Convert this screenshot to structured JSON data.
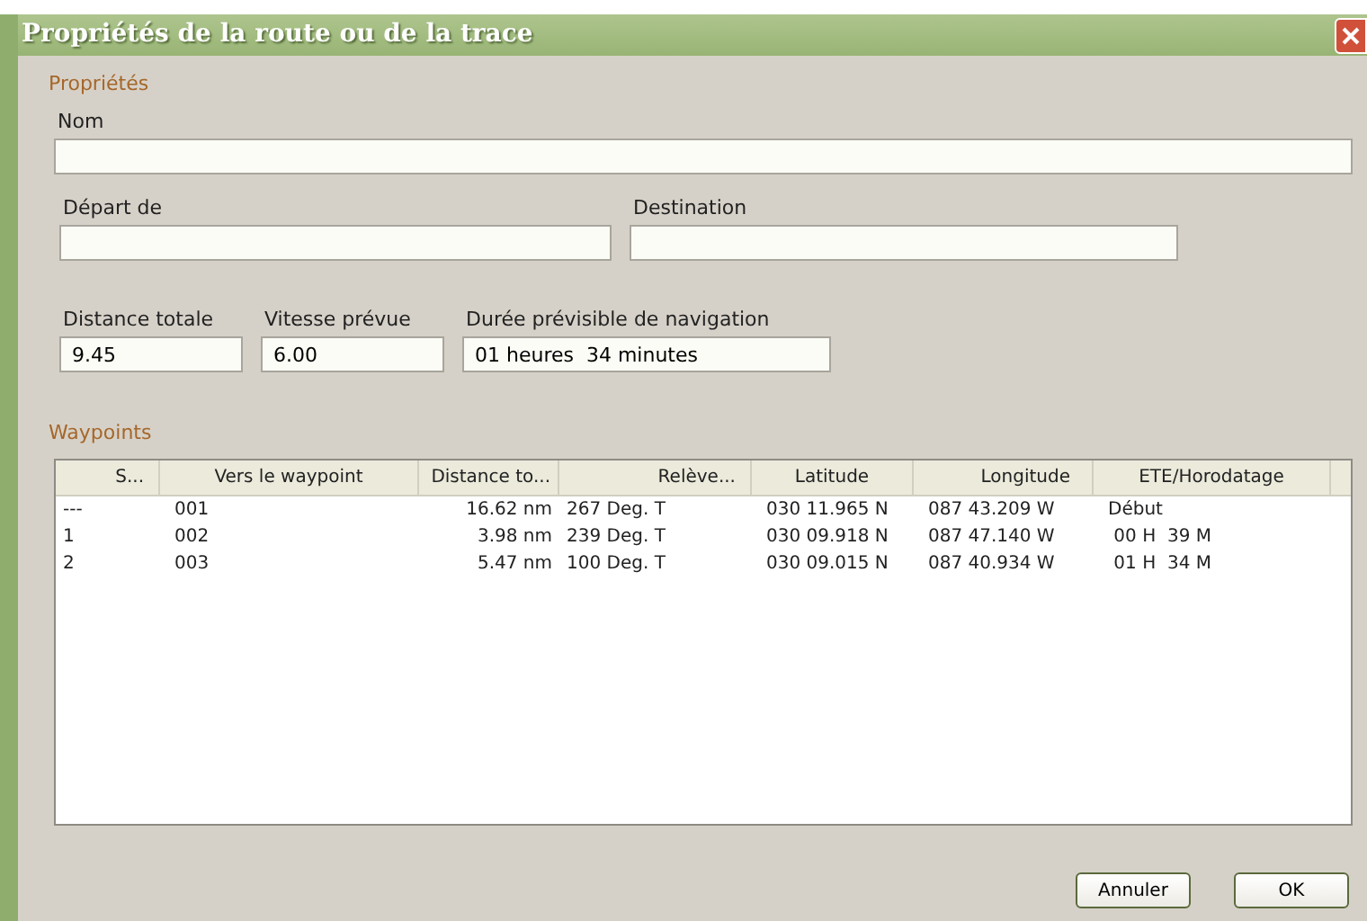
{
  "window": {
    "title": "Propriétés de la route ou de la trace"
  },
  "properties": {
    "heading": "Propriétés",
    "name": {
      "label": "Nom"
    },
    "departure": {
      "label": "Départ de"
    },
    "destination": {
      "label": "Destination"
    },
    "total_distance": {
      "label": "Distance totale",
      "value": "9.45"
    },
    "planned_speed": {
      "label": "Vitesse prévue",
      "value": "6.00"
    },
    "duration": {
      "label": "Durée prévisible de navigation",
      "value": "01 heures  34 minutes"
    }
  },
  "waypoints": {
    "heading": "Waypoints",
    "columns": [
      "S...",
      "Vers le waypoint",
      "Distance to...",
      "Relève...",
      "Latitude",
      "Longitude",
      "ETE/Horodatage"
    ],
    "rows": [
      [
        "---",
        "001",
        "16.62 nm",
        "267 Deg. T",
        "030 11.965 N",
        "087 43.209 W",
        "Début"
      ],
      [
        "1",
        "002",
        "3.98 nm",
        "239 Deg. T",
        "030 09.918 N",
        "087 47.140 W",
        " 00 H  39 M"
      ],
      [
        "2",
        "003",
        "5.47 nm",
        "100 Deg. T",
        "030 09.015 N",
        "087 40.934 W",
        " 01 H  34 M"
      ]
    ]
  },
  "buttons": [
    "Annuler",
    "OK"
  ]
}
